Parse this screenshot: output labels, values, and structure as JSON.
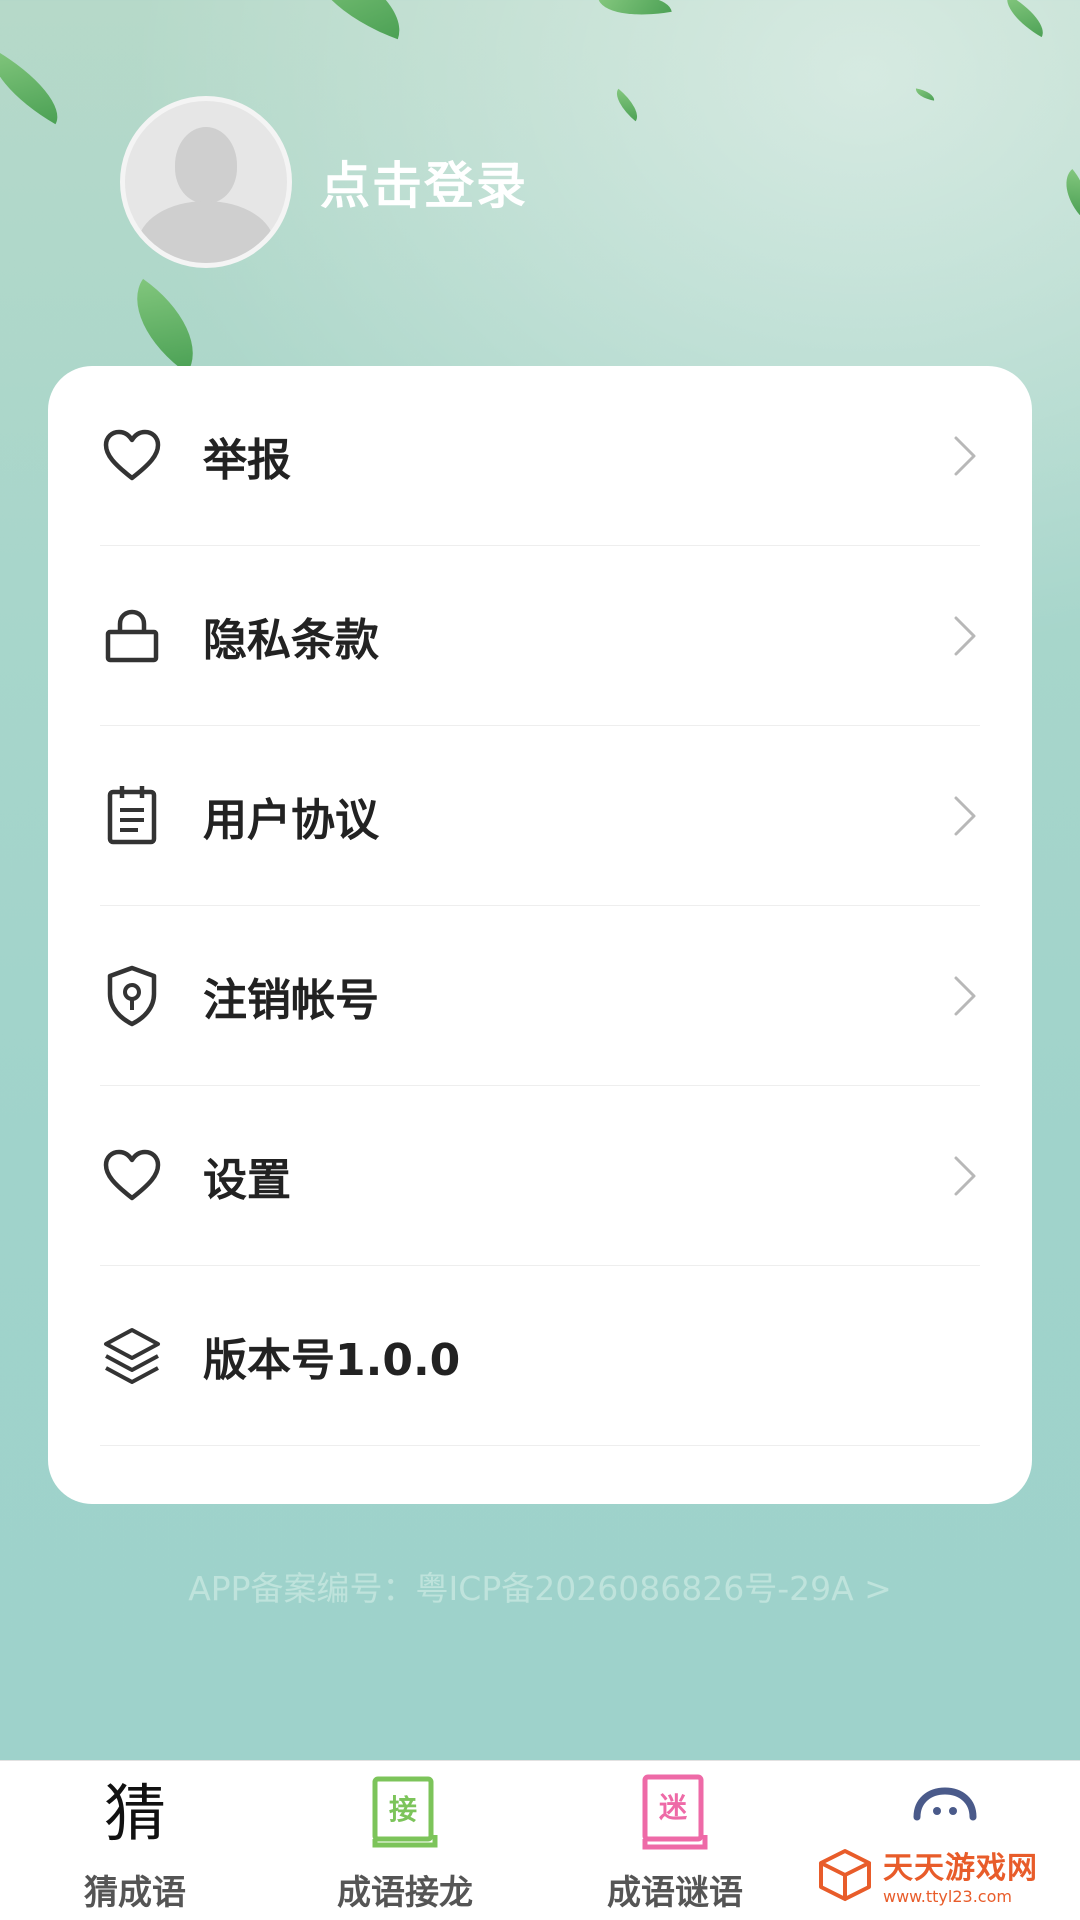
{
  "profile": {
    "login_label": "点击登录"
  },
  "menu": {
    "items": [
      {
        "label": "举报",
        "icon": "heart-icon",
        "has_arrow": true
      },
      {
        "label": "隐私条款",
        "icon": "lock-icon",
        "has_arrow": true
      },
      {
        "label": "用户协议",
        "icon": "clipboard-icon",
        "has_arrow": true
      },
      {
        "label": "注销帐号",
        "icon": "shield-key-icon",
        "has_arrow": true
      },
      {
        "label": "设置",
        "icon": "heart-icon",
        "has_arrow": true
      },
      {
        "label": "版本号1.0.0",
        "icon": "layers-icon",
        "has_arrow": false
      }
    ]
  },
  "footer": {
    "icp_text": "APP备案编号：粤ICP备2026086826号-29A >"
  },
  "tabbar": {
    "tabs": [
      {
        "label": "猜成语",
        "icon": "guess-char-icon",
        "icon_text": "猜"
      },
      {
        "label": "成语接龙",
        "icon": "book-jie-icon",
        "icon_text": "接"
      },
      {
        "label": "成语谜语",
        "icon": "book-mi-icon",
        "icon_text": "迷"
      },
      {
        "label": "",
        "icon": "chat-face-icon"
      }
    ]
  },
  "watermark": {
    "title": "天天游戏网",
    "url": "www.ttyl23.com"
  },
  "colors": {
    "background_top": "#b6d9c9",
    "background_bottom": "#9dd2cb",
    "card": "#ffffff",
    "text_primary": "#222222",
    "leaf": "#5cae58",
    "tab_jie": "#7cc45a",
    "tab_mi": "#ee6aa7",
    "tab_profile": "#4a5a8a",
    "watermark": "#e85c2a"
  }
}
